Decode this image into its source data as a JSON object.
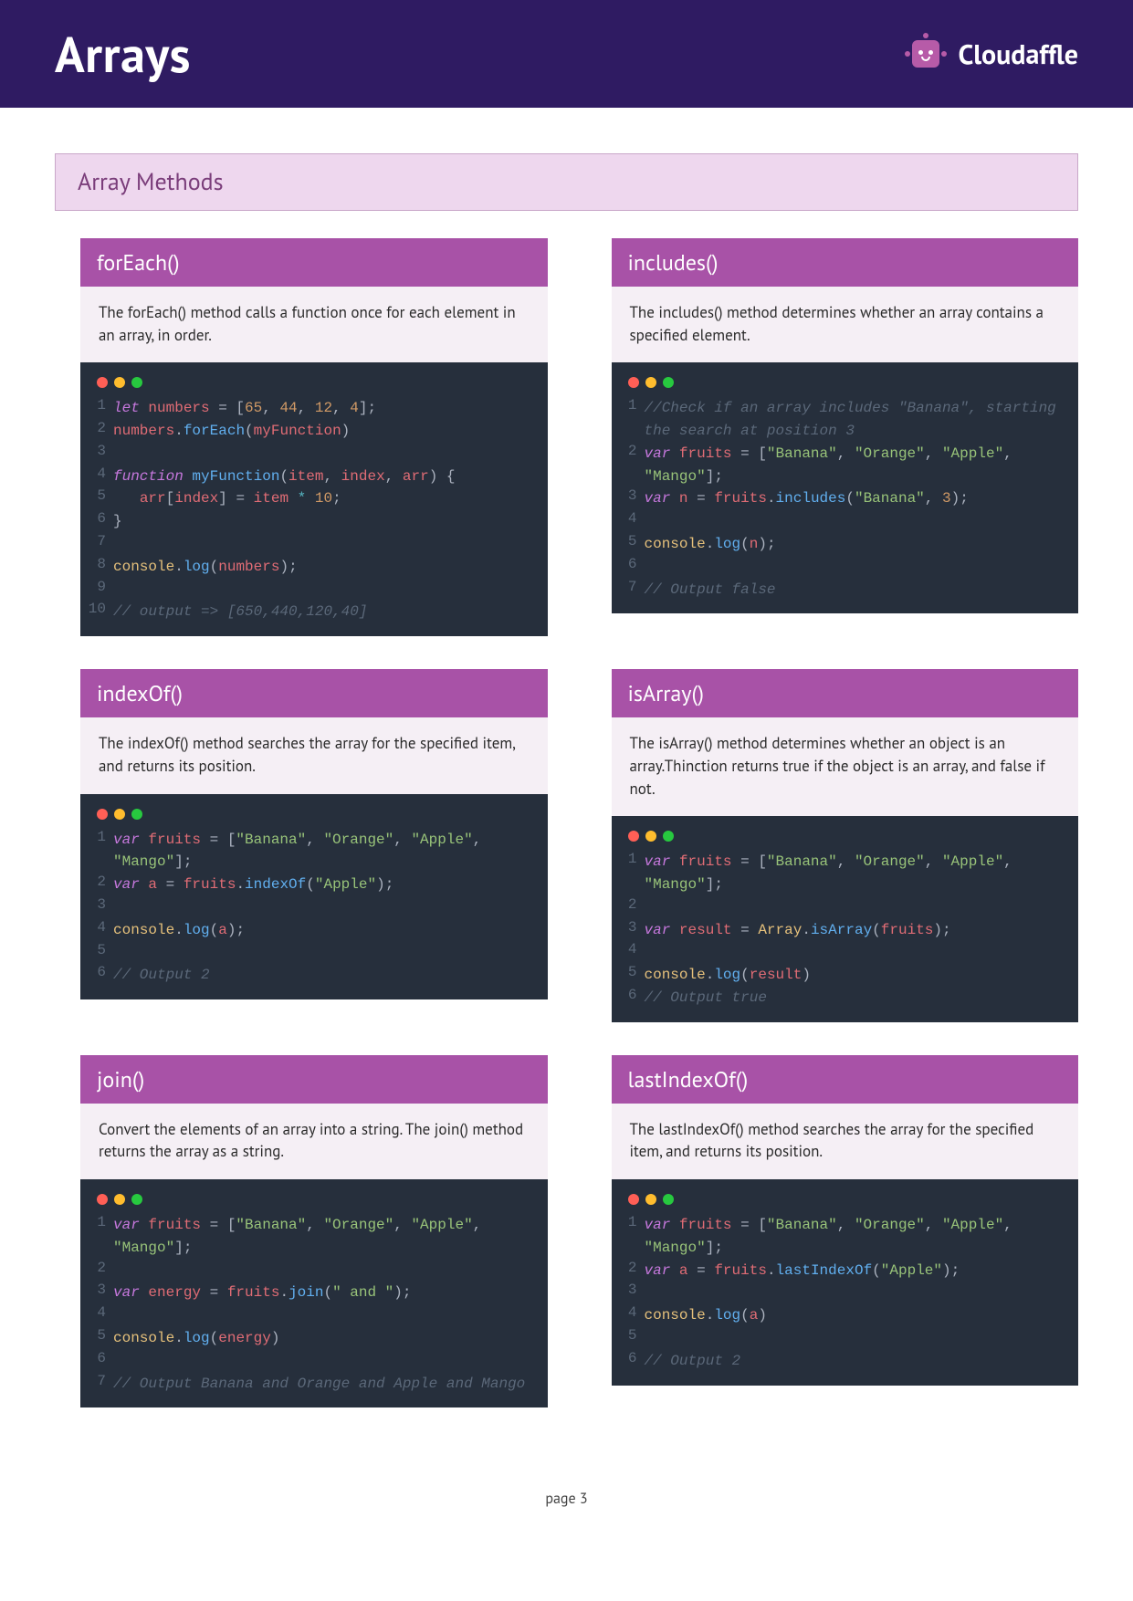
{
  "header": {
    "title": "Arrays",
    "brand": "Cloudaffle"
  },
  "section": {
    "title": "Array Methods"
  },
  "cards": [
    {
      "title": "forEach()",
      "desc": "The forEach() method calls a function once for each element in an array, in order.",
      "code": [
        [
          {
            "t": "let ",
            "c": "kw"
          },
          {
            "t": "numbers",
            "c": "var"
          },
          {
            "t": " = [",
            "c": "pun"
          },
          {
            "t": "65",
            "c": "num"
          },
          {
            "t": ", ",
            "c": "pun"
          },
          {
            "t": "44",
            "c": "num"
          },
          {
            "t": ", ",
            "c": "pun"
          },
          {
            "t": "12",
            "c": "num"
          },
          {
            "t": ", ",
            "c": "pun"
          },
          {
            "t": "4",
            "c": "num"
          },
          {
            "t": "];",
            "c": "pun"
          }
        ],
        [
          {
            "t": "numbers",
            "c": "var"
          },
          {
            "t": ".",
            "c": "pun"
          },
          {
            "t": "forEach",
            "c": "fn"
          },
          {
            "t": "(",
            "c": "pun"
          },
          {
            "t": "myFunction",
            "c": "var"
          },
          {
            "t": ")",
            "c": "pun"
          }
        ],
        [],
        [
          {
            "t": "function ",
            "c": "kw"
          },
          {
            "t": "myFunction",
            "c": "fn"
          },
          {
            "t": "(",
            "c": "pun"
          },
          {
            "t": "item",
            "c": "var"
          },
          {
            "t": ", ",
            "c": "pun"
          },
          {
            "t": "index",
            "c": "var"
          },
          {
            "t": ", ",
            "c": "pun"
          },
          {
            "t": "arr",
            "c": "var"
          },
          {
            "t": ") {",
            "c": "pun"
          }
        ],
        [
          {
            "t": "   arr",
            "c": "var"
          },
          {
            "t": "[",
            "c": "pun"
          },
          {
            "t": "index",
            "c": "var"
          },
          {
            "t": "] = ",
            "c": "pun"
          },
          {
            "t": "item",
            "c": "var"
          },
          {
            "t": " * ",
            "c": "op"
          },
          {
            "t": "10",
            "c": "num"
          },
          {
            "t": ";",
            "c": "pun"
          }
        ],
        [
          {
            "t": "}",
            "c": "pun"
          }
        ],
        [],
        [
          {
            "t": "console",
            "c": "id"
          },
          {
            "t": ".",
            "c": "pun"
          },
          {
            "t": "log",
            "c": "fn"
          },
          {
            "t": "(",
            "c": "pun"
          },
          {
            "t": "numbers",
            "c": "var"
          },
          {
            "t": ");",
            "c": "pun"
          }
        ],
        [],
        [
          {
            "t": "// output => [650,440,120,40]",
            "c": "cm"
          }
        ]
      ]
    },
    {
      "title": "includes()",
      "desc": "The includes() method determines whether an array contains a specified element.",
      "code": [
        [
          {
            "t": "//Check if an array includes \"Banana\", starting the search at position 3",
            "c": "cm"
          }
        ],
        [
          {
            "t": "var ",
            "c": "kw"
          },
          {
            "t": "fruits",
            "c": "var"
          },
          {
            "t": " = [",
            "c": "pun"
          },
          {
            "t": "\"Banana\"",
            "c": "str"
          },
          {
            "t": ", ",
            "c": "pun"
          },
          {
            "t": "\"Orange\"",
            "c": "str"
          },
          {
            "t": ", ",
            "c": "pun"
          },
          {
            "t": "\"Apple\"",
            "c": "str"
          },
          {
            "t": ", ",
            "c": "pun"
          },
          {
            "t": "\"Mango\"",
            "c": "str"
          },
          {
            "t": "];",
            "c": "pun"
          }
        ],
        [
          {
            "t": "var ",
            "c": "kw"
          },
          {
            "t": "n",
            "c": "var"
          },
          {
            "t": " = ",
            "c": "pun"
          },
          {
            "t": "fruits",
            "c": "var"
          },
          {
            "t": ".",
            "c": "pun"
          },
          {
            "t": "includes",
            "c": "fn"
          },
          {
            "t": "(",
            "c": "pun"
          },
          {
            "t": "\"Banana\"",
            "c": "str"
          },
          {
            "t": ", ",
            "c": "pun"
          },
          {
            "t": "3",
            "c": "num"
          },
          {
            "t": ");",
            "c": "pun"
          }
        ],
        [],
        [
          {
            "t": "console",
            "c": "id"
          },
          {
            "t": ".",
            "c": "pun"
          },
          {
            "t": "log",
            "c": "fn"
          },
          {
            "t": "(",
            "c": "pun"
          },
          {
            "t": "n",
            "c": "var"
          },
          {
            "t": ");",
            "c": "pun"
          }
        ],
        [],
        [
          {
            "t": "// Output false",
            "c": "cm"
          }
        ]
      ]
    },
    {
      "title": "indexOf()",
      "desc": "The indexOf() method searches the array for the specified item, and returns its position.",
      "code": [
        [
          {
            "t": "var ",
            "c": "kw"
          },
          {
            "t": "fruits",
            "c": "var"
          },
          {
            "t": " = [",
            "c": "pun"
          },
          {
            "t": "\"Banana\"",
            "c": "str"
          },
          {
            "t": ", ",
            "c": "pun"
          },
          {
            "t": "\"Orange\"",
            "c": "str"
          },
          {
            "t": ", ",
            "c": "pun"
          },
          {
            "t": "\"Apple\"",
            "c": "str"
          },
          {
            "t": ", ",
            "c": "pun"
          },
          {
            "t": "\"Mango\"",
            "c": "str"
          },
          {
            "t": "];",
            "c": "pun"
          }
        ],
        [
          {
            "t": "var ",
            "c": "kw"
          },
          {
            "t": "a",
            "c": "var"
          },
          {
            "t": " = ",
            "c": "pun"
          },
          {
            "t": "fruits",
            "c": "var"
          },
          {
            "t": ".",
            "c": "pun"
          },
          {
            "t": "indexOf",
            "c": "fn"
          },
          {
            "t": "(",
            "c": "pun"
          },
          {
            "t": "\"Apple\"",
            "c": "str"
          },
          {
            "t": ");",
            "c": "pun"
          }
        ],
        [],
        [
          {
            "t": "console",
            "c": "id"
          },
          {
            "t": ".",
            "c": "pun"
          },
          {
            "t": "log",
            "c": "fn"
          },
          {
            "t": "(",
            "c": "pun"
          },
          {
            "t": "a",
            "c": "var"
          },
          {
            "t": ");",
            "c": "pun"
          }
        ],
        [],
        [
          {
            "t": "// Output 2",
            "c": "cm"
          }
        ]
      ]
    },
    {
      "title": "isArray()",
      "desc": "The isArray() method determines whether an object is an array.Thinction returns true if the object is an array, and false if not.",
      "code": [
        [
          {
            "t": "var ",
            "c": "kw"
          },
          {
            "t": "fruits",
            "c": "var"
          },
          {
            "t": " = [",
            "c": "pun"
          },
          {
            "t": "\"Banana\"",
            "c": "str"
          },
          {
            "t": ", ",
            "c": "pun"
          },
          {
            "t": "\"Orange\"",
            "c": "str"
          },
          {
            "t": ", ",
            "c": "pun"
          },
          {
            "t": "\"Apple\"",
            "c": "str"
          },
          {
            "t": ", ",
            "c": "pun"
          },
          {
            "t": "\"Mango\"",
            "c": "str"
          },
          {
            "t": "];",
            "c": "pun"
          }
        ],
        [],
        [
          {
            "t": "var ",
            "c": "kw"
          },
          {
            "t": "result",
            "c": "var"
          },
          {
            "t": " = ",
            "c": "pun"
          },
          {
            "t": "Array",
            "c": "id"
          },
          {
            "t": ".",
            "c": "pun"
          },
          {
            "t": "isArray",
            "c": "fn"
          },
          {
            "t": "(",
            "c": "pun"
          },
          {
            "t": "fruits",
            "c": "var"
          },
          {
            "t": ");",
            "c": "pun"
          }
        ],
        [],
        [
          {
            "t": "console",
            "c": "id"
          },
          {
            "t": ".",
            "c": "pun"
          },
          {
            "t": "log",
            "c": "fn"
          },
          {
            "t": "(",
            "c": "pun"
          },
          {
            "t": "result",
            "c": "var"
          },
          {
            "t": ")",
            "c": "pun"
          }
        ],
        [
          {
            "t": "// Output true",
            "c": "cm"
          }
        ]
      ]
    },
    {
      "title": "join()",
      "desc": "Convert the elements of an array into a string. The join() method returns the array as a string.",
      "code": [
        [
          {
            "t": "var ",
            "c": "kw"
          },
          {
            "t": "fruits",
            "c": "var"
          },
          {
            "t": " = [",
            "c": "pun"
          },
          {
            "t": "\"Banana\"",
            "c": "str"
          },
          {
            "t": ", ",
            "c": "pun"
          },
          {
            "t": "\"Orange\"",
            "c": "str"
          },
          {
            "t": ", ",
            "c": "pun"
          },
          {
            "t": "\"Apple\"",
            "c": "str"
          },
          {
            "t": ", ",
            "c": "pun"
          },
          {
            "t": "\"Mango\"",
            "c": "str"
          },
          {
            "t": "];",
            "c": "pun"
          }
        ],
        [],
        [
          {
            "t": "var ",
            "c": "kw"
          },
          {
            "t": "energy",
            "c": "var"
          },
          {
            "t": " = ",
            "c": "pun"
          },
          {
            "t": "fruits",
            "c": "var"
          },
          {
            "t": ".",
            "c": "pun"
          },
          {
            "t": "join",
            "c": "fn"
          },
          {
            "t": "(",
            "c": "pun"
          },
          {
            "t": "\" and \"",
            "c": "str"
          },
          {
            "t": ");",
            "c": "pun"
          }
        ],
        [],
        [
          {
            "t": "console",
            "c": "id"
          },
          {
            "t": ".",
            "c": "pun"
          },
          {
            "t": "log",
            "c": "fn"
          },
          {
            "t": "(",
            "c": "pun"
          },
          {
            "t": "energy",
            "c": "var"
          },
          {
            "t": ")",
            "c": "pun"
          }
        ],
        [],
        [
          {
            "t": "// Output Banana and Orange and Apple and Mango",
            "c": "cm"
          }
        ]
      ]
    },
    {
      "title": "lastIndexOf()",
      "desc": "The lastIndexOf() method searches the array for the specified item, and returns its position.",
      "code": [
        [
          {
            "t": "var ",
            "c": "kw"
          },
          {
            "t": "fruits",
            "c": "var"
          },
          {
            "t": " = [",
            "c": "pun"
          },
          {
            "t": "\"Banana\"",
            "c": "str"
          },
          {
            "t": ", ",
            "c": "pun"
          },
          {
            "t": "\"Orange\"",
            "c": "str"
          },
          {
            "t": ", ",
            "c": "pun"
          },
          {
            "t": "\"Apple\"",
            "c": "str"
          },
          {
            "t": ", ",
            "c": "pun"
          },
          {
            "t": "\"Mango\"",
            "c": "str"
          },
          {
            "t": "];",
            "c": "pun"
          }
        ],
        [
          {
            "t": "var ",
            "c": "kw"
          },
          {
            "t": "a",
            "c": "var"
          },
          {
            "t": " = ",
            "c": "pun"
          },
          {
            "t": "fruits",
            "c": "var"
          },
          {
            "t": ".",
            "c": "pun"
          },
          {
            "t": "lastIndexOf",
            "c": "fn"
          },
          {
            "t": "(",
            "c": "pun"
          },
          {
            "t": "\"Apple\"",
            "c": "str"
          },
          {
            "t": ");",
            "c": "pun"
          }
        ],
        [],
        [
          {
            "t": "console",
            "c": "id"
          },
          {
            "t": ".",
            "c": "pun"
          },
          {
            "t": "log",
            "c": "fn"
          },
          {
            "t": "(",
            "c": "pun"
          },
          {
            "t": "a",
            "c": "var"
          },
          {
            "t": ")",
            "c": "pun"
          }
        ],
        [],
        [
          {
            "t": "// Output 2",
            "c": "cm"
          }
        ]
      ]
    }
  ],
  "footer": {
    "page_label": "page 3"
  }
}
